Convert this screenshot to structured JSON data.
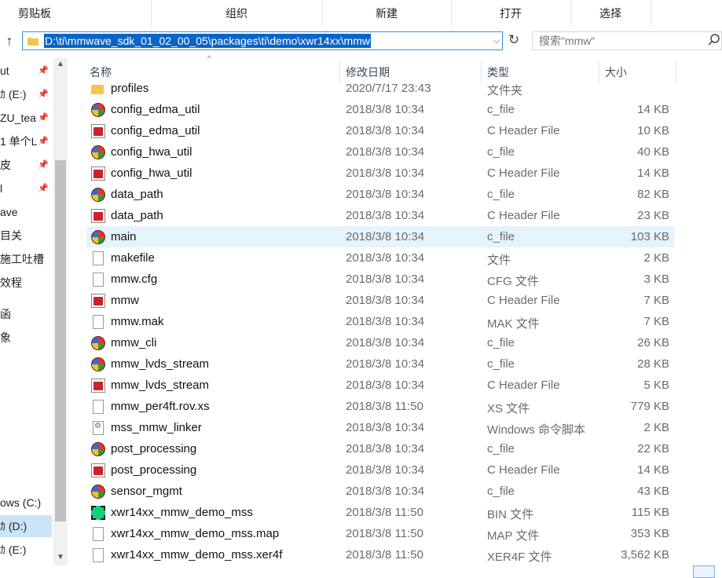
{
  "ribbon": {
    "groups": [
      "剪贴板",
      "组织",
      "新建",
      "打开",
      "选择"
    ]
  },
  "address": {
    "path": "D:\\ti\\mmwave_sdk_01_02_00_05\\packages\\ti\\demo\\xwr14xx\\mmw",
    "search_placeholder": "搜索\"mmw\""
  },
  "nav": {
    "items": [
      {
        "label": "ut",
        "pinned": true
      },
      {
        "label": "ｶ (E:)",
        "pinned": true
      },
      {
        "label": "ZU_tea",
        "pinned": true
      },
      {
        "label": "1 单个L",
        "pinned": true
      },
      {
        "label": "皮",
        "pinned": true
      },
      {
        "label": "l",
        "pinned": true
      },
      {
        "label": "ave",
        "pinned": false
      },
      {
        "label": "目关",
        "pinned": false
      },
      {
        "label": "施工吐槽",
        "pinned": false
      },
      {
        "label": "效程",
        "pinned": false
      },
      {
        "label": "函",
        "pinned": false
      },
      {
        "label": "象",
        "pinned": false
      },
      {
        "label": "ows (C:)",
        "pinned": false
      },
      {
        "label": "ｶ (D:)",
        "pinned": false,
        "selected": true
      },
      {
        "label": "ｶ (E:)",
        "pinned": false
      }
    ]
  },
  "columns": {
    "name": "名称",
    "date": "修改日期",
    "type": "类型",
    "size": "大小"
  },
  "files": [
    {
      "name": "profiles",
      "date": "2020/7/17 23:43",
      "type": "文件夹",
      "size": "",
      "icon": "folder-icon"
    },
    {
      "name": "config_edma_util",
      "date": "2018/3/8 10:34",
      "type": "c_file",
      "size": "14 KB",
      "icon": "c-file-icon"
    },
    {
      "name": "config_edma_util",
      "date": "2018/3/8 10:34",
      "type": "C Header File",
      "size": "10 KB",
      "icon": "c-header-icon"
    },
    {
      "name": "config_hwa_util",
      "date": "2018/3/8 10:34",
      "type": "c_file",
      "size": "40 KB",
      "icon": "c-file-icon"
    },
    {
      "name": "config_hwa_util",
      "date": "2018/3/8 10:34",
      "type": "C Header File",
      "size": "14 KB",
      "icon": "c-header-icon"
    },
    {
      "name": "data_path",
      "date": "2018/3/8 10:34",
      "type": "c_file",
      "size": "82 KB",
      "icon": "c-file-icon"
    },
    {
      "name": "data_path",
      "date": "2018/3/8 10:34",
      "type": "C Header File",
      "size": "23 KB",
      "icon": "c-header-icon"
    },
    {
      "name": "main",
      "date": "2018/3/8 10:34",
      "type": "c_file",
      "size": "103 KB",
      "icon": "c-file-icon",
      "selected": true
    },
    {
      "name": "makefile",
      "date": "2018/3/8 10:34",
      "type": "文件",
      "size": "2 KB",
      "icon": "document-icon"
    },
    {
      "name": "mmw.cfg",
      "date": "2018/3/8 10:34",
      "type": "CFG 文件",
      "size": "3 KB",
      "icon": "document-icon"
    },
    {
      "name": "mmw",
      "date": "2018/3/8 10:34",
      "type": "C Header File",
      "size": "7 KB",
      "icon": "c-header-icon"
    },
    {
      "name": "mmw.mak",
      "date": "2018/3/8 10:34",
      "type": "MAK 文件",
      "size": "7 KB",
      "icon": "document-icon"
    },
    {
      "name": "mmw_cli",
      "date": "2018/3/8 10:34",
      "type": "c_file",
      "size": "26 KB",
      "icon": "c-file-icon"
    },
    {
      "name": "mmw_lvds_stream",
      "date": "2018/3/8 10:34",
      "type": "c_file",
      "size": "28 KB",
      "icon": "c-file-icon"
    },
    {
      "name": "mmw_lvds_stream",
      "date": "2018/3/8 10:34",
      "type": "C Header File",
      "size": "5 KB",
      "icon": "c-header-icon"
    },
    {
      "name": "mmw_per4ft.rov.xs",
      "date": "2018/3/8 11:50",
      "type": "XS 文件",
      "size": "779 KB",
      "icon": "document-icon"
    },
    {
      "name": "mss_mmw_linker",
      "date": "2018/3/8 10:34",
      "type": "Windows 命令脚本",
      "size": "2 KB",
      "icon": "command-script-icon"
    },
    {
      "name": "post_processing",
      "date": "2018/3/8 10:34",
      "type": "c_file",
      "size": "22 KB",
      "icon": "c-file-icon"
    },
    {
      "name": "post_processing",
      "date": "2018/3/8 10:34",
      "type": "C Header File",
      "size": "14 KB",
      "icon": "c-header-icon"
    },
    {
      "name": "sensor_mgmt",
      "date": "2018/3/8 10:34",
      "type": "c_file",
      "size": "43 KB",
      "icon": "c-file-icon"
    },
    {
      "name": "xwr14xx_mmw_demo_mss",
      "date": "2018/3/8 11:50",
      "type": "BIN 文件",
      "size": "115 KB",
      "icon": "bin-file-icon"
    },
    {
      "name": "xwr14xx_mmw_demo_mss.map",
      "date": "2018/3/8 11:50",
      "type": "MAP 文件",
      "size": "353 KB",
      "icon": "document-icon"
    },
    {
      "name": "xwr14xx_mmw_demo_mss.xer4f",
      "date": "2018/3/8 11:50",
      "type": "XER4F 文件",
      "size": "3,562 KB",
      "icon": "document-icon"
    }
  ],
  "colors": {
    "selection": "#cce4f7",
    "hover_row": "#e5f3fb",
    "address_highlight": "#0a64c8"
  }
}
